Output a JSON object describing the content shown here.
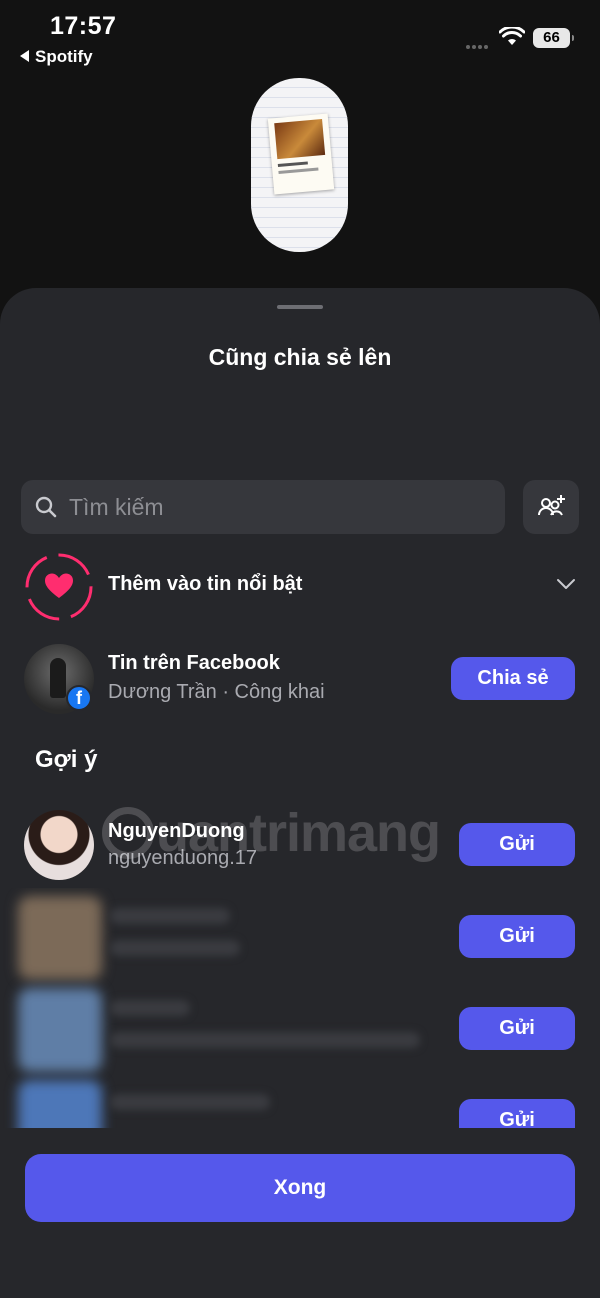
{
  "status": {
    "time": "17:57",
    "back_app": "Spotify",
    "battery": "66"
  },
  "sheet": {
    "title": "Cũng chia sẻ lên"
  },
  "search": {
    "placeholder": "Tìm kiếm"
  },
  "highlight": {
    "label": "Thêm vào tin nổi bật"
  },
  "facebook_story": {
    "title": "Tin trên Facebook",
    "subtitle": "Dương Trần · Công khai",
    "button": "Chia sẻ"
  },
  "suggestions": {
    "label": "Gợi ý",
    "items": [
      {
        "name": "NguyenDuong",
        "username": "nguyenduong.17",
        "button": "Gửi"
      },
      {
        "button": "Gửi"
      },
      {
        "button": "Gửi"
      },
      {
        "button": "Gửi"
      }
    ]
  },
  "watermark": "uantrimang",
  "done_button": "Xong",
  "colors": {
    "accent": "#5558eb",
    "sheet": "#26272b",
    "highlight_pink": "#ff2d6f",
    "facebook_blue": "#1877f2"
  }
}
